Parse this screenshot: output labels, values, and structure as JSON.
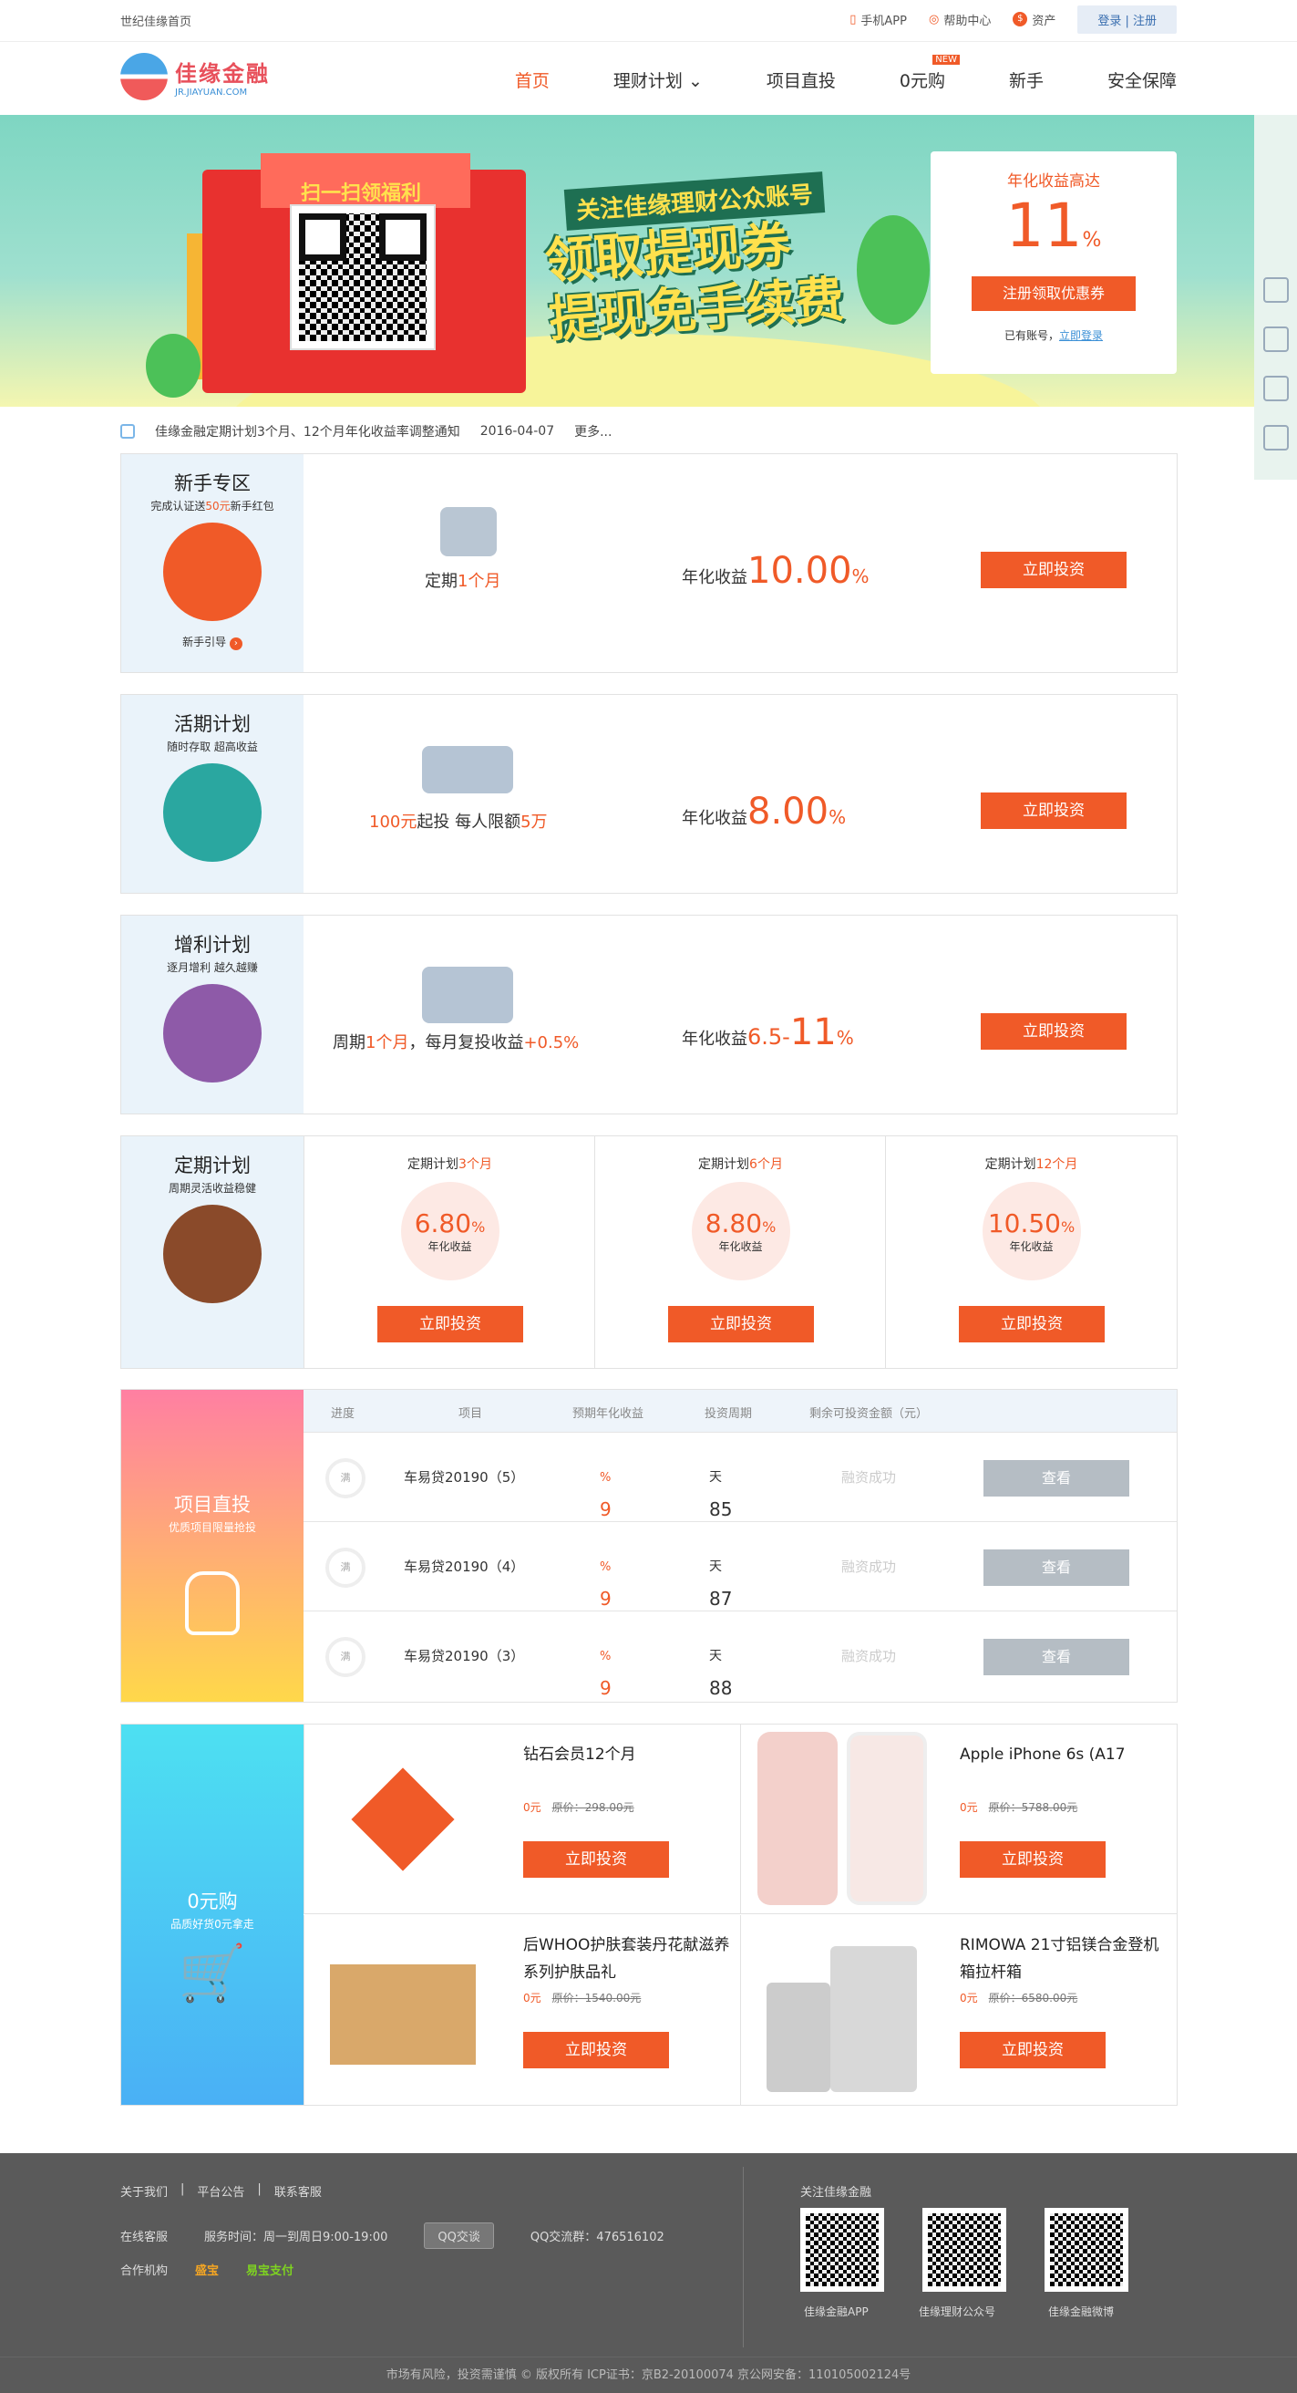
{
  "topbar": {
    "home": "世纪佳缘首页",
    "app": "手机APP",
    "help": "帮助中心",
    "assets": "资产",
    "login": "登录 | 注册"
  },
  "logo": {
    "name": "佳缘金融",
    "domain": "JR.JIAYUAN.COM"
  },
  "nav": {
    "items": [
      "首页",
      "理财计划",
      "项目直投",
      "0元购",
      "新手",
      "安全保障"
    ],
    "new_badge": "NEW"
  },
  "banner": {
    "scan": "扫一扫领福利",
    "sub": "关注佳缘理财公众账号",
    "line1": "领取提现券",
    "line2": "提现免手续费"
  },
  "rate_card": {
    "label": "年化收益高达",
    "value": "11",
    "unit": "%",
    "button": "注册领取优惠券",
    "has_account": "已有账号，",
    "login_now": "立即登录"
  },
  "notice": {
    "text": "佳缘金融定期计划3个月、12个月年化收益率调整通知",
    "date": "2016-04-07",
    "more": "更多..."
  },
  "newbie": {
    "title": "新手专区",
    "sub_a": "完成认证送",
    "sub_b": "50元",
    "sub_c": "新手红包",
    "guide": "新手引导",
    "period_a": "定期",
    "period_b": "1个月",
    "rate_label": "年化收益",
    "rate": "10.00",
    "pct": "%",
    "button": "立即投资"
  },
  "current": {
    "title": "活期计划",
    "sub": "随时存取 超高收益",
    "min": "100元",
    "start": "起投  每人限额",
    "limit": "5万",
    "rate_label": "年化收益",
    "rate": "8.00",
    "pct": "%",
    "button": "立即投资"
  },
  "profit": {
    "title": "增利计划",
    "sub": "逐月增利 越久越赚",
    "p1": "周期",
    "p2": "1个月",
    "p3": "，每月复投收益",
    "p4": "+0.5%",
    "rate_label": "年化收益",
    "rate_a": "6.5-",
    "rate_b": "11",
    "pct": "%",
    "button": "立即投资"
  },
  "fixed": {
    "title": "定期计划",
    "sub": "周期灵活收益稳健",
    "prefix": "定期计划",
    "cols": [
      {
        "m": "3个月",
        "rate": "6.80"
      },
      {
        "m": "6个月",
        "rate": "8.80"
      },
      {
        "m": "12个月",
        "rate": "10.50"
      }
    ],
    "pct": "%",
    "label": "年化收益",
    "button": "立即投资"
  },
  "projects": {
    "title": "项目直投",
    "sub": "优质项目限量抢投",
    "headers": [
      "进度",
      "项目",
      "预期年化收益",
      "投资周期",
      "剩余可投资金额（元）"
    ],
    "rows": [
      {
        "progress": "满",
        "name": "车易贷20190（5）",
        "rate": "9",
        "days": "85"
      },
      {
        "progress": "满",
        "name": "车易贷20190（4）",
        "rate": "9",
        "days": "87"
      },
      {
        "progress": "满",
        "name": "车易贷20190（3）",
        "rate": "9",
        "days": "88"
      }
    ],
    "pct": "%",
    "day_unit": "天",
    "status": "融资成功",
    "button": "查看"
  },
  "zero": {
    "title": "0元购",
    "sub": "品质好货0元拿走",
    "items": [
      {
        "name": "钻石会员12个月",
        "price": "0元",
        "orig": "原价：298.00元"
      },
      {
        "name": "Apple iPhone 6s (A17",
        "price": "0元",
        "orig": "原价：5788.00元"
      },
      {
        "name": "后WHOO护肤套装丹花献滋养系列护肤品礼",
        "price": "0元",
        "orig": "原价：1540.00元"
      },
      {
        "name": "RIMOWA 21寸铝镁合金登机箱拉杆箱",
        "price": "0元",
        "orig": "原价：6580.00元"
      }
    ],
    "button": "立即投资"
  },
  "footer": {
    "about": "关于我们",
    "notice": "平台公告",
    "contact": "联系客服",
    "online": "在线客服",
    "hours": "服务时间：周一到周日9:00-19:00",
    "qq_btn": "QQ交谈",
    "qq_group": "QQ交流群：476516102",
    "partners": "合作机构",
    "p1": "盛宝",
    "p2": "易宝支付",
    "follow": "关注佳缘金融",
    "qr": [
      "佳缘金融APP",
      "佳缘理财公众号",
      "佳缘金融微博"
    ],
    "bottom": "市场有风险，投资需谨慎      © 版权所有 ICP证书：京B2-20100074  京公网安备：110105002124号"
  },
  "colors": {
    "accent": "#f05a28",
    "link": "#3a8fd6",
    "banner": "#7ed6c2",
    "footer": "#5a5a5a"
  }
}
